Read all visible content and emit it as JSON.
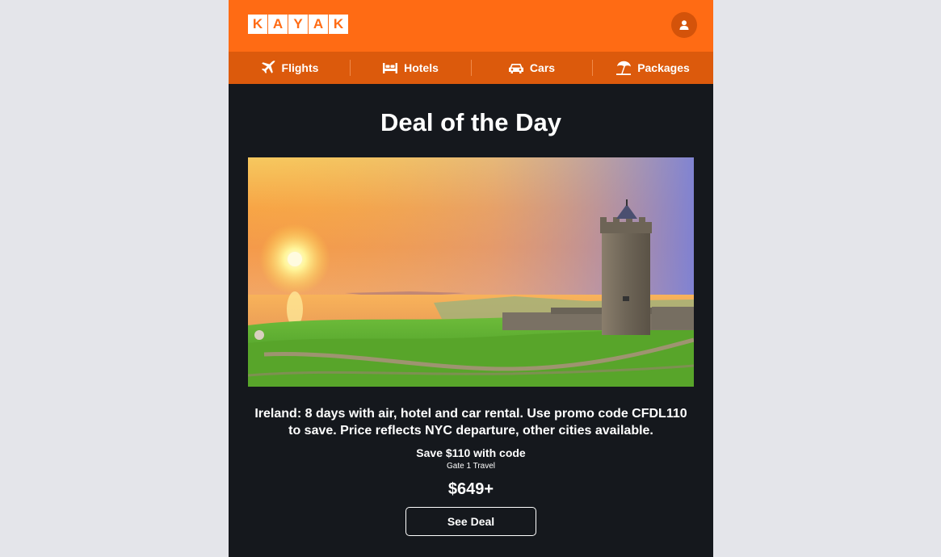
{
  "brand": {
    "logo_letters": [
      "K",
      "A",
      "Y",
      "A",
      "K"
    ],
    "primary_color": "#ff6b14",
    "nav_color": "#dc5a0c",
    "background_color": "#15181d"
  },
  "header": {
    "account_icon": "user-icon"
  },
  "nav": {
    "items": [
      {
        "label": "Flights",
        "icon": "plane-icon"
      },
      {
        "label": "Hotels",
        "icon": "bed-icon"
      },
      {
        "label": "Cars",
        "icon": "car-icon"
      },
      {
        "label": "Packages",
        "icon": "beach-umbrella-icon"
      }
    ]
  },
  "deal": {
    "headline": "Deal of the Day",
    "description": "Ireland: 8 days with air, hotel and car rental. Use promo code CFDL110 to save. Price reflects NYC departure, other cities available.",
    "savings": "Save $110 with code",
    "provider": "Gate 1 Travel",
    "price": "$649+",
    "cta_label": "See Deal"
  }
}
